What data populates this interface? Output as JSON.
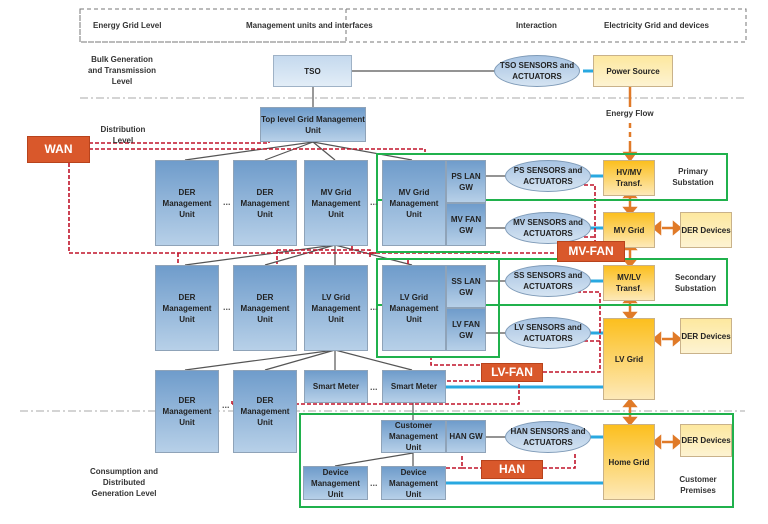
{
  "header": {
    "col_energy_level": "Energy Grid Level",
    "col_management": "Management units and interfaces",
    "col_interaction": "Interaction",
    "col_grid_devices": "Electricity Grid and devices"
  },
  "levels": {
    "bulk": "Bulk Generation and Transmission Level",
    "distribution": "Distribution Level",
    "consumption": "Consumption and Distributed Generation Level"
  },
  "energy_flow_label": "Energy Flow",
  "ellipsis": "...",
  "networks": {
    "wan": "WAN",
    "mv_fan": "MV-FAN",
    "lv_fan": "LV-FAN",
    "han": "HAN"
  },
  "units": {
    "tso": "TSO",
    "top_level": "Top level Grid Management Unit",
    "der_mgmt": "DER Management Unit",
    "mv_grid_mgmt": "MV Grid Management Unit",
    "lv_grid_mgmt": "LV Grid Management Unit",
    "smart_meter": "Smart Meter",
    "customer_mgmt": "Customer Management Unit",
    "device_mgmt": "Device Management Unit",
    "ps_lan_gw": "PS LAN GW",
    "mv_fan_gw": "MV FAN GW",
    "ss_lan_gw": "SS LAN GW",
    "lv_fan_gw": "LV FAN GW",
    "han_gw": "HAN GW"
  },
  "sensors": {
    "tso": "TSO SENSORS and ACTUATORS",
    "ps": "PS SENSORS and ACTUATORS",
    "mv": "MV SENSORS and ACTUATORS",
    "ss": "SS SENSORS and ACTUATORS",
    "lv": "LV SENSORS and ACTUATORS",
    "han": "HAN SENSORS and ACTUATORS"
  },
  "grid": {
    "power_source": "Power Source",
    "hv_mv": "HV/MV Transf.",
    "mv_grid": "MV Grid",
    "mv_lv": "MV/LV Transf.",
    "lv_grid": "LV Grid",
    "home_grid": "Home Grid",
    "der_devices": "DER Devices"
  },
  "zones": {
    "primary": "Primary Substation",
    "secondary": "Secondary Substation",
    "customer": "Customer Premises"
  }
}
